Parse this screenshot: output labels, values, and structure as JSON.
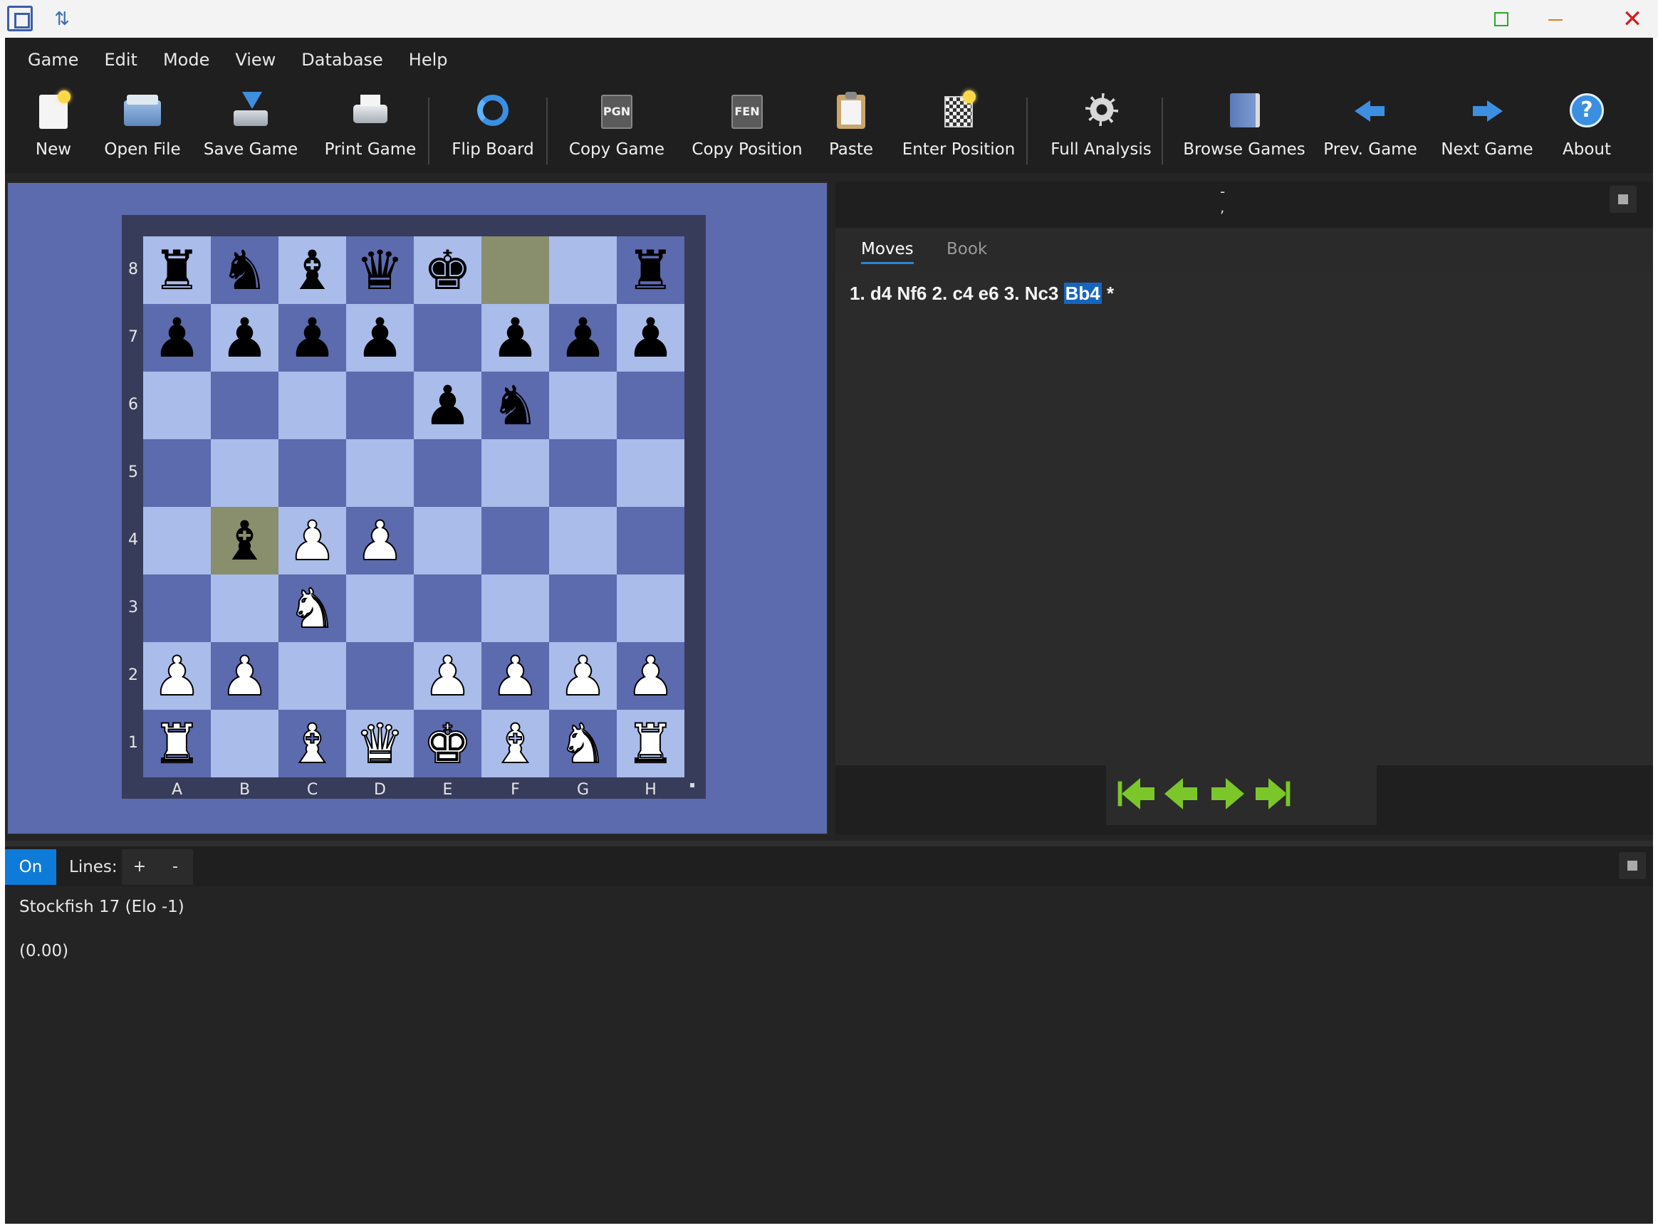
{
  "window": {
    "controls": {
      "maximize": "maximize",
      "minimize": "minimize",
      "close": "close"
    }
  },
  "menu": [
    "Game",
    "Edit",
    "Mode",
    "View",
    "Database",
    "Help"
  ],
  "toolbar": [
    {
      "label": "New",
      "icon": "new-document-icon"
    },
    {
      "label": "Open File",
      "icon": "folder-open-icon"
    },
    {
      "label": "Save Game",
      "icon": "save-icon"
    },
    {
      "label": "Print Game",
      "icon": "printer-icon"
    },
    {
      "label": "Flip Board",
      "icon": "flip-board-icon"
    },
    {
      "label": "Copy Game",
      "icon": "copy-pgn-icon",
      "badge": "PGN"
    },
    {
      "label": "Copy Position",
      "icon": "copy-fen-icon",
      "badge": "FEN"
    },
    {
      "label": "Paste",
      "icon": "clipboard-icon"
    },
    {
      "label": "Enter Position",
      "icon": "board-setup-icon"
    },
    {
      "label": "Full Analysis",
      "icon": "gear-icon"
    },
    {
      "label": "Browse Games",
      "icon": "book-icon"
    },
    {
      "label": "Prev. Game",
      "icon": "arrow-left-icon"
    },
    {
      "label": "Next Game",
      "icon": "arrow-right-icon"
    },
    {
      "label": "About",
      "icon": "help-icon"
    }
  ],
  "board": {
    "ranks": [
      "8",
      "7",
      "6",
      "5",
      "4",
      "3",
      "2",
      "1"
    ],
    "files": [
      "A",
      "B",
      "C",
      "D",
      "E",
      "F",
      "G",
      "H"
    ],
    "position": [
      [
        "bR",
        "bN",
        "bB",
        "bQ",
        "bK",
        "",
        "",
        "bR"
      ],
      [
        "bP",
        "bP",
        "bP",
        "bP",
        "",
        "bP",
        "bP",
        "bP"
      ],
      [
        "",
        "",
        "",
        "",
        "bP",
        "bN",
        "",
        ""
      ],
      [
        "",
        "",
        "",
        "",
        "",
        "",
        "",
        ""
      ],
      [
        "",
        "bB",
        "wP",
        "wP",
        "",
        "",
        "",
        ""
      ],
      [
        "",
        "",
        "wN",
        "",
        "",
        "",
        "",
        ""
      ],
      [
        "wP",
        "wP",
        "",
        "",
        "wP",
        "wP",
        "wP",
        "wP"
      ],
      [
        "wR",
        "",
        "wB",
        "wQ",
        "wK",
        "wB",
        "wN",
        "wR"
      ]
    ],
    "last_move_squares": [
      "f8",
      "b4"
    ],
    "colors": {
      "light": "#a9bcea",
      "dark": "#5c6aae",
      "highlight": "#898e6c"
    }
  },
  "game_header": {
    "line1": "-",
    "line2": ","
  },
  "tabs": [
    {
      "label": "Moves",
      "active": true
    },
    {
      "label": "Book",
      "active": false
    }
  ],
  "moves": {
    "text_before": "1. d4 Nf6 2. c4 e6 3. Nc3 ",
    "current": "Bb4",
    "result": " *"
  },
  "nav": [
    "first-move",
    "previous-move",
    "next-move",
    "last-move"
  ],
  "engine": {
    "on_label": "On",
    "lines_label": "Lines:",
    "plus_label": "+",
    "minus_label": "-",
    "name": "Stockfish 17 (Elo -1)",
    "score": "(0.00)"
  }
}
